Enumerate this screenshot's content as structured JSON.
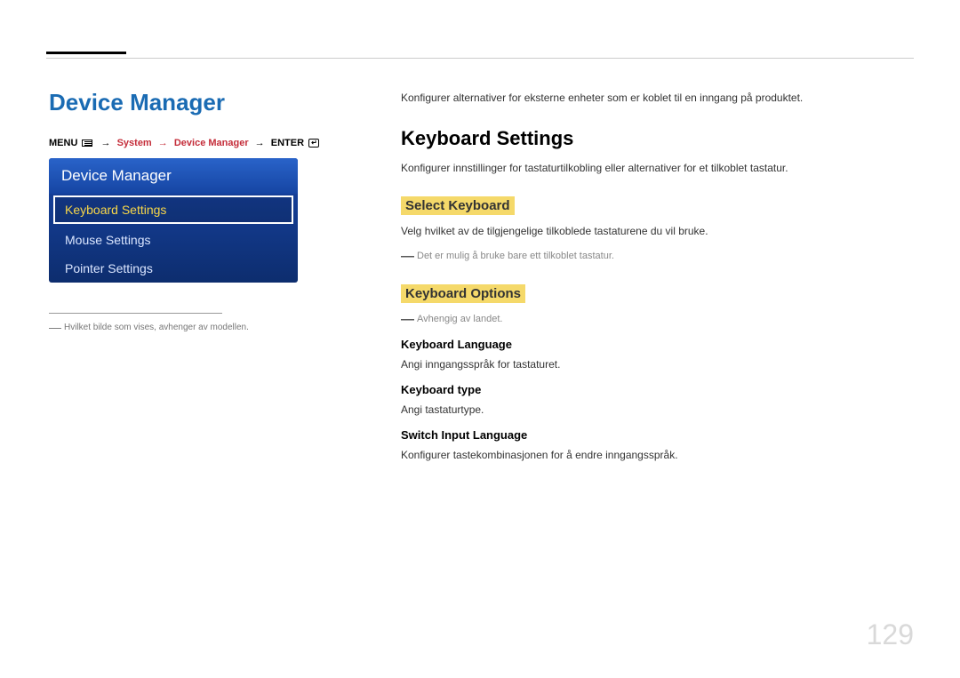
{
  "page_title": "Device Manager",
  "breadcrumb": {
    "menu_label": "MENU",
    "system": "System",
    "device_manager": "Device Manager",
    "enter_label": "ENTER"
  },
  "panel": {
    "header": "Device Manager",
    "items": [
      {
        "label": "Keyboard Settings",
        "selected": true
      },
      {
        "label": "Mouse Settings",
        "selected": false
      },
      {
        "label": "Pointer Settings",
        "selected": false
      }
    ]
  },
  "panel_note": "Hvilket bilde som vises, avhenger av modellen.",
  "content": {
    "intro": "Konfigurer alternativer for eksterne enheter som er koblet til en inngang på produktet.",
    "h1": "Keyboard Settings",
    "h1_desc": "Konfigurer innstillinger for tastaturtilkobling eller alternativer for et tilkoblet tastatur.",
    "select_keyboard": "Select Keyboard",
    "select_keyboard_desc": "Velg hvilket av de tilgjengelige tilkoblede tastaturene du vil bruke.",
    "select_keyboard_note": "Det er mulig å bruke bare ett tilkoblet tastatur.",
    "keyboard_options": "Keyboard Options",
    "keyboard_options_note": "Avhengig av landet.",
    "keyboard_language": "Keyboard Language",
    "keyboard_language_desc": "Angi inngangsspråk for tastaturet.",
    "keyboard_type": "Keyboard type",
    "keyboard_type_desc": "Angi tastaturtype.",
    "switch_input_language": "Switch Input Language",
    "switch_input_desc": "Konfigurer tastekombinasjonen for å endre inngangsspråk."
  },
  "page_number": "129"
}
